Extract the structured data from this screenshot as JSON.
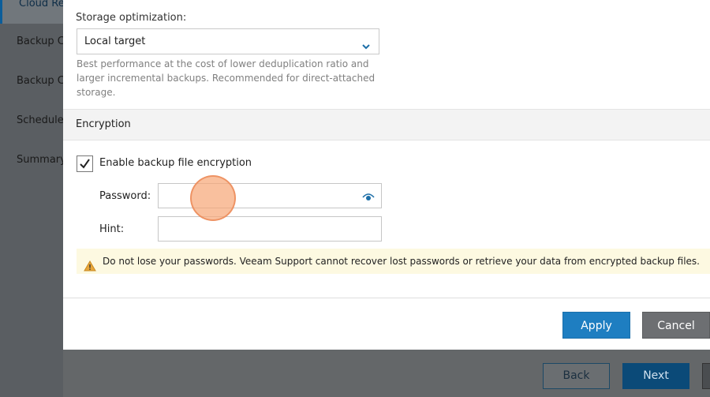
{
  "wizard": {
    "steps": [
      "Cloud Re",
      "Backup C",
      "Backup C",
      "Schedule",
      "Summary"
    ],
    "back_label": "Back",
    "next_label": "Next"
  },
  "dialog": {
    "storage_label": "Storage optimization:",
    "storage_value": "Local target",
    "storage_hint": "Best performance at the cost of lower deduplication ratio and larger incremental backups. Recommended for direct-attached storage.",
    "encryption_header": "Encryption",
    "enable_encryption_label": "Enable backup file encryption",
    "enable_encryption_checked": true,
    "password_label": "Password:",
    "password_value": "",
    "hint_label": "Hint:",
    "hint_value": "",
    "warning_text": "Do not lose your passwords. Veeam Support cannot recover lost passwords or retrieve your data from encrypted backup files.",
    "apply_label": "Apply",
    "cancel_label": "Cancel"
  },
  "colors": {
    "accent": "#1e7ec1",
    "warning_bg": "#fdf9e1",
    "click_indicator": "#f6a878"
  },
  "icons": [
    "chevron-down-icon",
    "checkmark-icon",
    "eye-icon",
    "warning-icon"
  ]
}
